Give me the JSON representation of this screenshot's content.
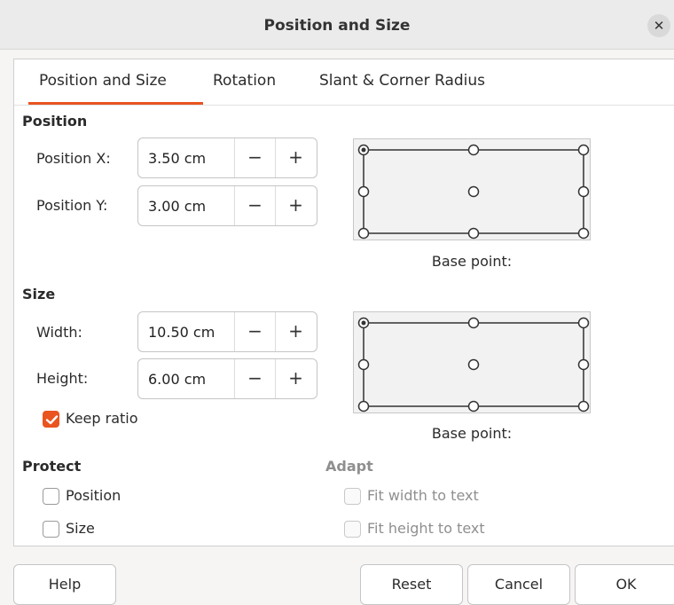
{
  "window": {
    "title": "Position and Size",
    "close_icon": "close-icon"
  },
  "tabs": [
    {
      "label": "Position and Size",
      "active": true
    },
    {
      "label": "Rotation",
      "active": false
    },
    {
      "label": "Slant & Corner Radius",
      "active": false
    }
  ],
  "position": {
    "heading": "Position",
    "x": {
      "label": "Position X:",
      "value": "3.50 cm"
    },
    "y": {
      "label": "Position Y:",
      "value": "3.00 cm"
    },
    "base_point_label": "Base point:",
    "base_point_selected": "top-left"
  },
  "size": {
    "heading": "Size",
    "width": {
      "label": "Width:",
      "value": "10.50 cm"
    },
    "height": {
      "label": "Height:",
      "value": "6.00 cm"
    },
    "keep_ratio": {
      "label": "Keep ratio",
      "checked": true
    },
    "base_point_label": "Base point:",
    "base_point_selected": "top-left"
  },
  "spin": {
    "minus": "−",
    "plus": "+"
  },
  "protect": {
    "heading": "Protect",
    "position": {
      "label": "Position",
      "checked": false
    },
    "size": {
      "label": "Size",
      "checked": false
    }
  },
  "adapt": {
    "heading": "Adapt",
    "fit_width": {
      "label": "Fit width to text",
      "checked": false,
      "enabled": false
    },
    "fit_height": {
      "label": "Fit height to text",
      "checked": false,
      "enabled": false
    }
  },
  "buttons": {
    "help": "Help",
    "reset": "Reset",
    "cancel": "Cancel",
    "ok": "OK"
  },
  "colors": {
    "accent": "#e95420"
  }
}
